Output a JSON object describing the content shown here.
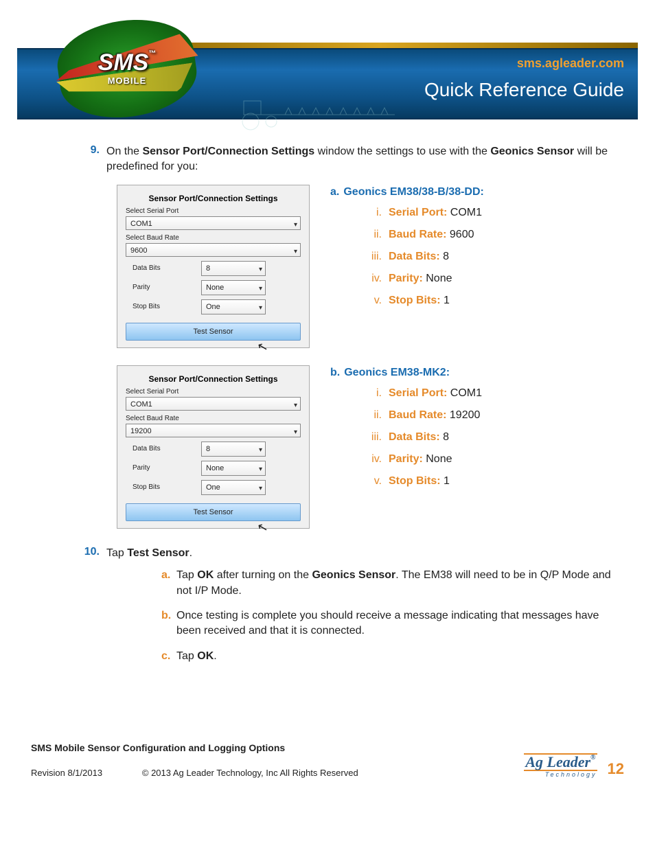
{
  "banner": {
    "logo_text": "SMS",
    "logo_tm": "™",
    "logo_sub": "MOBILE",
    "url": "sms.agleader.com",
    "title": "Quick Reference Guide"
  },
  "step9": {
    "num": "9.",
    "text_a": "On the ",
    "bold_a": "Sensor Port/Connection Settings",
    "text_b": " window the settings to use with the ",
    "bold_b": "Geonics Sensor",
    "text_c": " will be predefined for you:"
  },
  "dialog": {
    "title": "Sensor Port/Connection Settings",
    "serial_label": "Select Serial Port",
    "baud_label": "Select Baud Rate",
    "databits_label": "Data Bits",
    "parity_label": "Parity",
    "stopbits_label": "Stop Bits",
    "test_btn": "Test Sensor",
    "a": {
      "com": "COM1",
      "baud": "9600",
      "databits": "8",
      "parity": "None",
      "stopbits": "One"
    },
    "b": {
      "com": "COM1",
      "baud": "19200",
      "databits": "8",
      "parity": "None",
      "stopbits": "One"
    }
  },
  "spec_a": {
    "letter": "a.",
    "title": "Geonics EM38/38-B/38-DD:",
    "rows": [
      {
        "i": "i.",
        "label": "Serial Port:",
        "val": " COM1"
      },
      {
        "i": "ii.",
        "label": "Baud Rate:",
        "val": " 9600"
      },
      {
        "i": "iii.",
        "label": "Data Bits:",
        "val": " 8"
      },
      {
        "i": "iv.",
        "label": "Parity:",
        "val": " None"
      },
      {
        "i": "v.",
        "label": "Stop Bits:",
        "val": " 1"
      }
    ]
  },
  "spec_b": {
    "letter": "b.",
    "title": "Geonics EM38-MK2:",
    "rows": [
      {
        "i": "i.",
        "label": "Serial Port:",
        "val": " COM1"
      },
      {
        "i": "ii.",
        "label": "Baud Rate:",
        "val": " 19200"
      },
      {
        "i": "iii.",
        "label": "Data Bits:",
        "val": " 8"
      },
      {
        "i": "iv.",
        "label": "Parity:",
        "val": " None"
      },
      {
        "i": "v.",
        "label": "Stop Bits:",
        "val": " 1"
      }
    ]
  },
  "step10": {
    "num": "10.",
    "text_a": "Tap ",
    "bold_a": "Test Sensor",
    "text_b": ".",
    "subs": [
      {
        "l": "a.",
        "pre": "Tap ",
        "b1": "OK",
        "mid": " after turning on the ",
        "b2": "Geonics Sensor",
        "post": ". The EM38 will need to be in Q/P Mode and not I/P Mode."
      },
      {
        "l": "b.",
        "pre": "Once testing is complete you should receive a message indicating that messages have been received and that it is connected.",
        "b1": "",
        "mid": "",
        "b2": "",
        "post": ""
      },
      {
        "l": "c.",
        "pre": "Tap ",
        "b1": "OK",
        "mid": ".",
        "b2": "",
        "post": ""
      }
    ]
  },
  "footer": {
    "title": "SMS Mobile Sensor Configuration and Logging Options",
    "rev": "Revision 8/1/2013",
    "copy": "© 2013 Ag Leader Technology, Inc All Rights Reserved",
    "brand": "Ag Leader",
    "brand_sub": "Technology",
    "page": "12"
  }
}
